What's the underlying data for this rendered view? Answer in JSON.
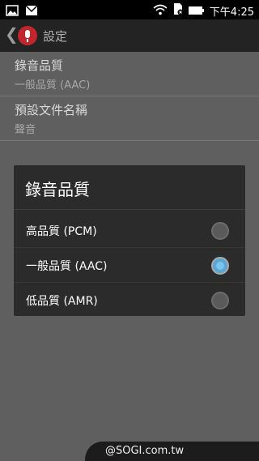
{
  "statusbar": {
    "time": "下午4:25"
  },
  "actionbar": {
    "title": "設定"
  },
  "preferences": [
    {
      "title": "錄音品質",
      "summary": "一般品質 (AAC)"
    },
    {
      "title": "預設文件名稱",
      "summary": "聲音"
    }
  ],
  "dialog": {
    "title": "錄音品質",
    "options": [
      {
        "label": "高品質 (PCM)",
        "selected": false
      },
      {
        "label": "一般品質 (AAC)",
        "selected": true
      },
      {
        "label": "低品質 (AMR)",
        "selected": false
      }
    ]
  },
  "watermark": "@SOGI.com.tw"
}
